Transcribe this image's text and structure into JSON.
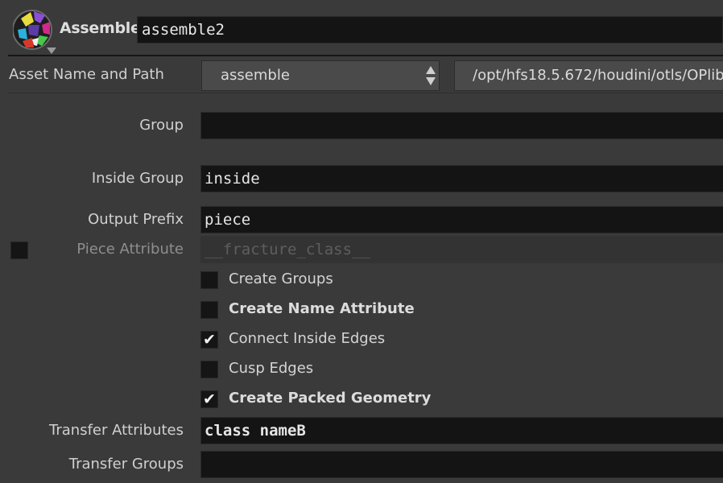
{
  "header": {
    "node_icon": "assemble-node-icon",
    "node_type": "Assemble",
    "node_name": "assemble2"
  },
  "asset": {
    "label": "Asset Name and Path",
    "name": "assemble",
    "path": "/opt/hfs18.5.672/houdini/otls/OPlib"
  },
  "params": {
    "group": {
      "label": "Group",
      "value": ""
    },
    "inside_group": {
      "label": "Inside Group",
      "value": "inside"
    },
    "output_prefix": {
      "label": "Output Prefix",
      "value": "piece"
    },
    "piece_attribute": {
      "label": "Piece Attribute",
      "value": "__fracture_class__",
      "enabled": false
    },
    "transfer_attributes": {
      "label": "Transfer Attributes",
      "value": "class nameB"
    },
    "transfer_groups": {
      "label": "Transfer Groups",
      "value": ""
    }
  },
  "checkboxes": [
    {
      "label": "Create Groups",
      "checked": false
    },
    {
      "label": "Create Name Attribute",
      "checked": false
    },
    {
      "label": "Connect Inside Edges",
      "checked": true
    },
    {
      "label": "Cusp Edges",
      "checked": false
    },
    {
      "label": "Create Packed Geometry",
      "checked": true
    }
  ],
  "check_glyph": "✔"
}
